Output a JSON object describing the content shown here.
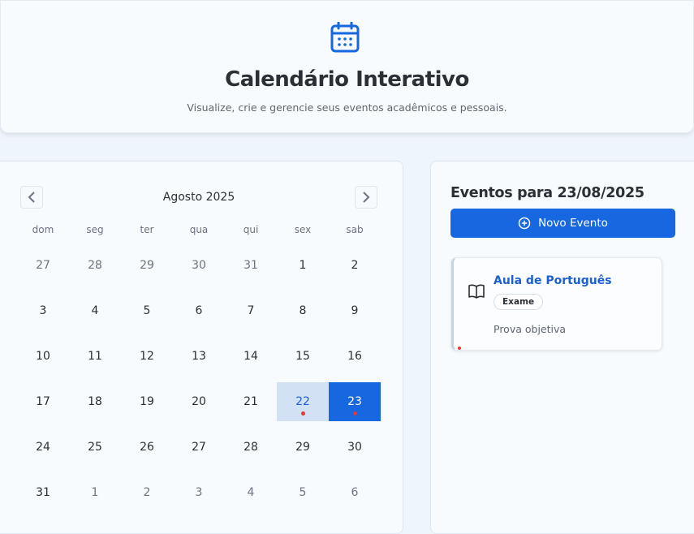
{
  "header": {
    "icon": "calendar-icon",
    "title": "Calendário Interativo",
    "subtitle": "Visualize, crie e gerencie seus eventos acadêmicos e pessoais."
  },
  "calendar": {
    "month_label": "Agosto 2025",
    "prev_icon": "chevron-left-icon",
    "next_icon": "chevron-right-icon",
    "weekdays": [
      "dom",
      "seg",
      "ter",
      "qua",
      "qui",
      "sex",
      "sab"
    ],
    "days": [
      {
        "label": "27",
        "other": true
      },
      {
        "label": "28",
        "other": true
      },
      {
        "label": "29",
        "other": true
      },
      {
        "label": "30",
        "other": true
      },
      {
        "label": "31",
        "other": true
      },
      {
        "label": "1"
      },
      {
        "label": "2"
      },
      {
        "label": "3"
      },
      {
        "label": "4"
      },
      {
        "label": "5"
      },
      {
        "label": "6"
      },
      {
        "label": "7"
      },
      {
        "label": "8"
      },
      {
        "label": "9"
      },
      {
        "label": "10"
      },
      {
        "label": "11"
      },
      {
        "label": "12"
      },
      {
        "label": "13"
      },
      {
        "label": "14"
      },
      {
        "label": "15"
      },
      {
        "label": "16"
      },
      {
        "label": "17"
      },
      {
        "label": "18"
      },
      {
        "label": "19"
      },
      {
        "label": "20"
      },
      {
        "label": "21"
      },
      {
        "label": "22",
        "today": true,
        "has_event": true
      },
      {
        "label": "23",
        "selected": true,
        "has_event": true
      },
      {
        "label": "24"
      },
      {
        "label": "25"
      },
      {
        "label": "26"
      },
      {
        "label": "27"
      },
      {
        "label": "28"
      },
      {
        "label": "29"
      },
      {
        "label": "30"
      },
      {
        "label": "31"
      },
      {
        "label": "1",
        "other": true
      },
      {
        "label": "2",
        "other": true
      },
      {
        "label": "3",
        "other": true
      },
      {
        "label": "4",
        "other": true
      },
      {
        "label": "5",
        "other": true
      },
      {
        "label": "6",
        "other": true
      }
    ]
  },
  "events_panel": {
    "heading": "Eventos para 23/08/2025",
    "new_button": {
      "label": "Novo Evento",
      "icon": "plus-circle-icon"
    },
    "events": [
      {
        "icon": "book-open-icon",
        "title": "Aula de Português",
        "tag": "Exame",
        "description": "Prova objetiva"
      }
    ]
  },
  "colors": {
    "accent": "#1767e0",
    "today_bg": "#d3e1f4",
    "event_dot": "#e53935"
  }
}
